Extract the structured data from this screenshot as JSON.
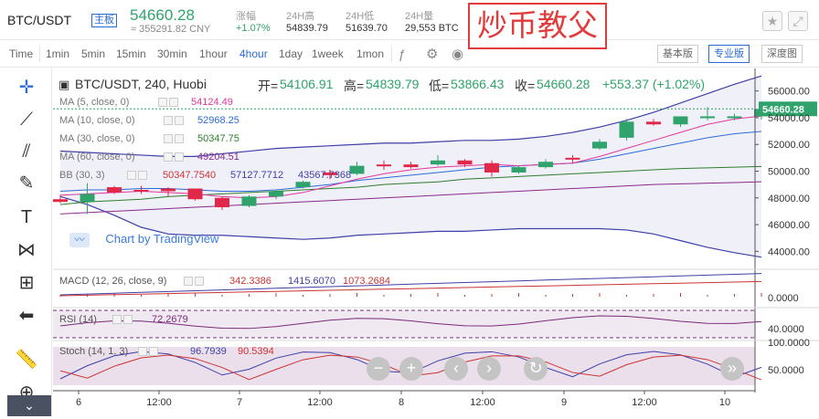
{
  "header": {
    "pair": "BTC/USDT",
    "tag": "主板",
    "price": "54660.28",
    "cny": "≈ 355291.82 CNY",
    "stats": [
      {
        "label": "涨幅",
        "value": "+1.07%"
      },
      {
        "label": "24H高",
        "value": "54839.79"
      },
      {
        "label": "24H低",
        "value": "51639.70"
      },
      {
        "label": "24H量",
        "value": "29,553 BTC"
      }
    ],
    "overlay_text": "炒币教父",
    "star_icon": "star-icon",
    "fullscreen_icon": "expand-icon"
  },
  "toolbar": {
    "timeframes": [
      "Time",
      "1min",
      "5min",
      "15min",
      "30min",
      "1hour",
      "4hour",
      "1day",
      "1week",
      "1mon"
    ],
    "active_timeframe": "4hour",
    "versions": [
      "基本版",
      "专业版",
      "深度图"
    ],
    "active_version": "专业版"
  },
  "legend": {
    "title": "BTC/USDT, 240, Huobi",
    "ohlc_open_label": "开=",
    "ohlc_open": "54106.91",
    "ohlc_high_label": "高=",
    "ohlc_high": "54839.79",
    "ohlc_low_label": "低=",
    "ohlc_low": "53866.43",
    "ohlc_close_label": "收=",
    "ohlc_close": "54660.28",
    "change": "+553.37 (+1.02%)",
    "ma5_label": "MA (5, close, 0)",
    "ma5_value": "54124.49",
    "ma10_label": "MA (10, close, 0)",
    "ma10_value": "52968.25",
    "ma30_label": "MA (30, close, 0)",
    "ma30_value": "50347.75",
    "ma60_label": "MA (60, close, 0)",
    "ma60_value": "49204.51",
    "bb_label": "BB (30, 3)",
    "bb_v1": "50347.7540",
    "bb_v2": "57127.7712",
    "bb_v3": "43567.7368",
    "watermark": "Chart by TradingView",
    "macd_label": "MACD (12, 26, close, 9)",
    "macd_v1": "342.3386",
    "macd_v2": "1415.6070",
    "macd_v3": "1073.2684",
    "rsi_label": "RSI (14)",
    "rsi_value": "72.2679",
    "stoch_label": "Stoch (14, 1, 3)",
    "stoch_v1": "96.7939",
    "stoch_v2": "90.5394"
  },
  "axes": {
    "price_ticks": [
      "56000.00",
      "54000.00",
      "52000.00",
      "50000.00",
      "48000.00",
      "46000.00",
      "44000.00"
    ],
    "current_price_tag": "54660.28",
    "macd_ticks": [
      "0.0000"
    ],
    "rsi_ticks": [
      "40.0000"
    ],
    "stoch_ticks": [
      "100.0000",
      "50.0000"
    ],
    "x_labels": [
      "6",
      "12:00",
      "7",
      "12:00",
      "8",
      "12:00",
      "9",
      "12:00",
      "10"
    ]
  },
  "colors": {
    "up": "#2fa36b",
    "down": "#e0294a",
    "accent": "#2c6bd6",
    "bb_band": "#3f3fa8",
    "ma5": "#e0389c",
    "ma10": "#2c6bd6",
    "ma30": "#2f7d2f",
    "ma60": "#8b2a8b"
  },
  "chart_data": {
    "type": "candlestick",
    "interval": "4hour",
    "candles_ohlc": [
      [
        47900,
        48200,
        47700,
        47600
      ],
      [
        47700,
        49100,
        48300,
        46800
      ],
      [
        48800,
        48900,
        48400,
        48300
      ],
      [
        48600,
        48900,
        48500,
        48300
      ],
      [
        48700,
        48800,
        48500,
        48100
      ],
      [
        48700,
        48700,
        47900,
        47800
      ],
      [
        48000,
        48100,
        47300,
        47100
      ],
      [
        47400,
        48200,
        48100,
        47300
      ],
      [
        48100,
        48600,
        48500,
        47900
      ],
      [
        48800,
        49300,
        49200,
        48700
      ],
      [
        49900,
        50100,
        49700,
        49400
      ],
      [
        49800,
        50700,
        50400,
        49700
      ],
      [
        50500,
        50800,
        50400,
        50100
      ],
      [
        50500,
        50700,
        50300,
        50200
      ],
      [
        50500,
        51200,
        50800,
        50400
      ],
      [
        50800,
        50900,
        50500,
        50300
      ],
      [
        50600,
        50800,
        49900,
        49600
      ],
      [
        49900,
        50400,
        50300,
        49800
      ],
      [
        50300,
        50900,
        50700,
        50200
      ],
      [
        51000,
        51200,
        50900,
        50600
      ],
      [
        51700,
        52400,
        52200,
        51600
      ],
      [
        52500,
        53900,
        53700,
        52300
      ],
      [
        53700,
        53900,
        53500,
        53400
      ],
      [
        53500,
        54100,
        54100,
        53300
      ],
      [
        54100,
        54800,
        54100,
        53800
      ],
      [
        54100,
        54300,
        54100,
        53800
      ],
      [
        54100,
        54800,
        54660,
        53866
      ]
    ],
    "ma5": [
      48200,
      48300,
      48400,
      48500,
      48400,
      48300,
      48100,
      48000,
      48100,
      48400,
      48900,
      49400,
      49800,
      50100,
      50300,
      50400,
      50500,
      50400,
      50500,
      50600,
      51100,
      51700,
      52300,
      52900,
      53500,
      53900,
      54124
    ],
    "ma10": [
      48500,
      48600,
      48600,
      48700,
      48700,
      48600,
      48500,
      48500,
      48600,
      48800,
      49000,
      49300,
      49500,
      49700,
      49900,
      50100,
      50300,
      50400,
      50500,
      50600,
      50900,
      51300,
      51700,
      52100,
      52500,
      52800,
      52968
    ],
    "ma30": [
      47500,
      47700,
      47800,
      47900,
      48100,
      48200,
      48300,
      48400,
      48500,
      48600,
      48700,
      48800,
      49000,
      49100,
      49200,
      49400,
      49500,
      49600,
      49700,
      49800,
      49900,
      50000,
      50100,
      50200,
      50250,
      50300,
      50347
    ],
    "ma60": [
      46800,
      46900,
      47000,
      47100,
      47200,
      47300,
      47400,
      47500,
      47600,
      47700,
      47800,
      47900,
      48000,
      48100,
      48200,
      48300,
      48400,
      48500,
      48600,
      48700,
      48800,
      48900,
      49000,
      49050,
      49100,
      49150,
      49204
    ],
    "bb_upper": [
      51500,
      51400,
      51300,
      51200,
      51100,
      51100,
      51300,
      51500,
      51700,
      51800,
      51900,
      52000,
      52100,
      52100,
      52200,
      52300,
      52300,
      52400,
      52600,
      52900,
      53300,
      53800,
      54400,
      55100,
      55800,
      56500,
      57127
    ],
    "bb_lower": [
      48100,
      47500,
      46700,
      45800,
      45300,
      45200,
      45200,
      45100,
      45000,
      44900,
      45000,
      45200,
      45300,
      45400,
      45500,
      45500,
      45600,
      45700,
      45700,
      45700,
      45700,
      45600,
      45300,
      44800,
      44300,
      43900,
      43567
    ],
    "ylim": [
      43000,
      57000
    ],
    "x_labels": [
      "6",
      "12:00",
      "7",
      "12:00",
      "8",
      "12:00",
      "9",
      "12:00",
      "10"
    ]
  }
}
